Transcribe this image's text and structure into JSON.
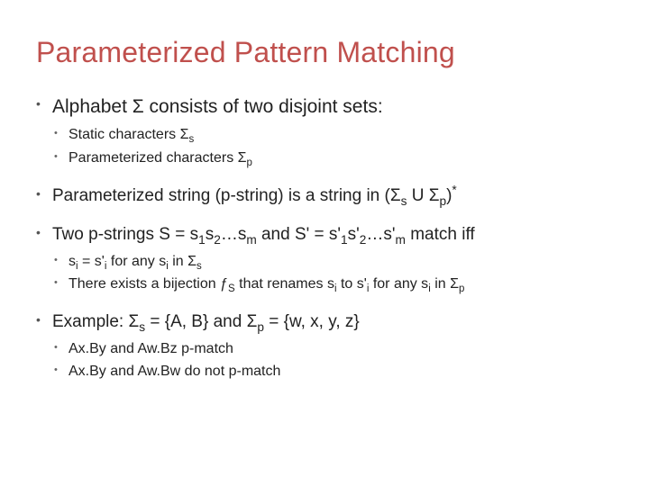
{
  "title": "Parameterized Pattern Matching",
  "b1": {
    "text": "Alphabet Σ consists of two disjoint sets:",
    "sub": [
      "Static characters Σ<sub>s</sub>",
      "Parameterized characters Σ<sub>p</sub>"
    ]
  },
  "b2": "Parameterized string (p-string) is a string in (Σ<sub>s</sub> U Σ<sub>p</sub>)<sup>*</sup>",
  "b3": {
    "text": "Two p-strings S = s<sub>1</sub>s<sub>2</sub>…s<sub>m</sub> and S' = s'<sub>1</sub>s'<sub>2</sub>…s'<sub>m</sub> match iff",
    "sub": [
      "s<sub>i</sub> = s'<sub>i</sub> for any s<sub>i</sub> in Σ<sub>s</sub>",
      "There exists a bijection ƒ<sub>S</sub> that renames s<sub>i</sub> to s'<sub>i</sub> for any s<sub>i</sub> in Σ<sub>p</sub>"
    ]
  },
  "b4": {
    "text": "Example: Σ<sub>s</sub> = {A, B} and Σ<sub>p</sub> = {w, x, y, z}",
    "sub": [
      "Ax.By and Aw.Bz p-match",
      "Ax.By and Aw.Bw do not p-match"
    ]
  }
}
